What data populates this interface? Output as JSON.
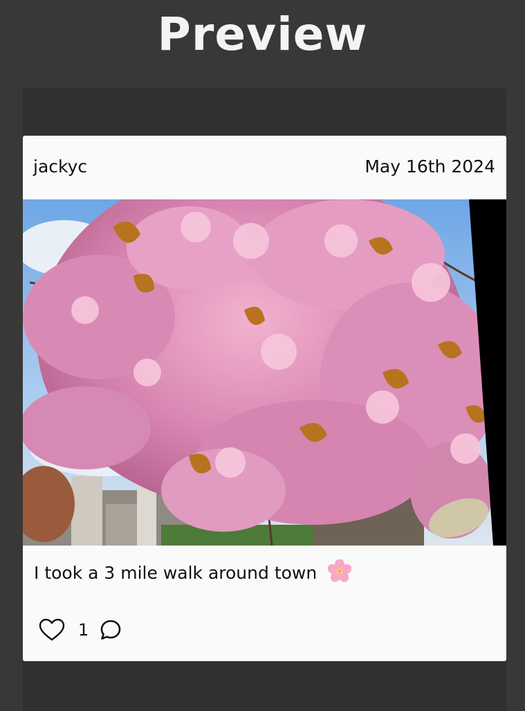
{
  "page": {
    "title": "Preview"
  },
  "post": {
    "username": "jackyc",
    "date": "May 16th 2024",
    "caption": "I took a 3 mile walk around town",
    "caption_emoji": "cherry-blossom-icon",
    "like_count": "1",
    "like_icon": "heart-icon",
    "comment_icon": "comment-bubble-icon"
  },
  "colors": {
    "background": "#393837",
    "frame": "#313030",
    "card": "#fafafa",
    "title_text": "#f4f4f4",
    "text": "#111111",
    "blossom_pink": "#e08fb8",
    "sky_blue": "#8bbcec",
    "leaf_brown": "#b87322"
  }
}
